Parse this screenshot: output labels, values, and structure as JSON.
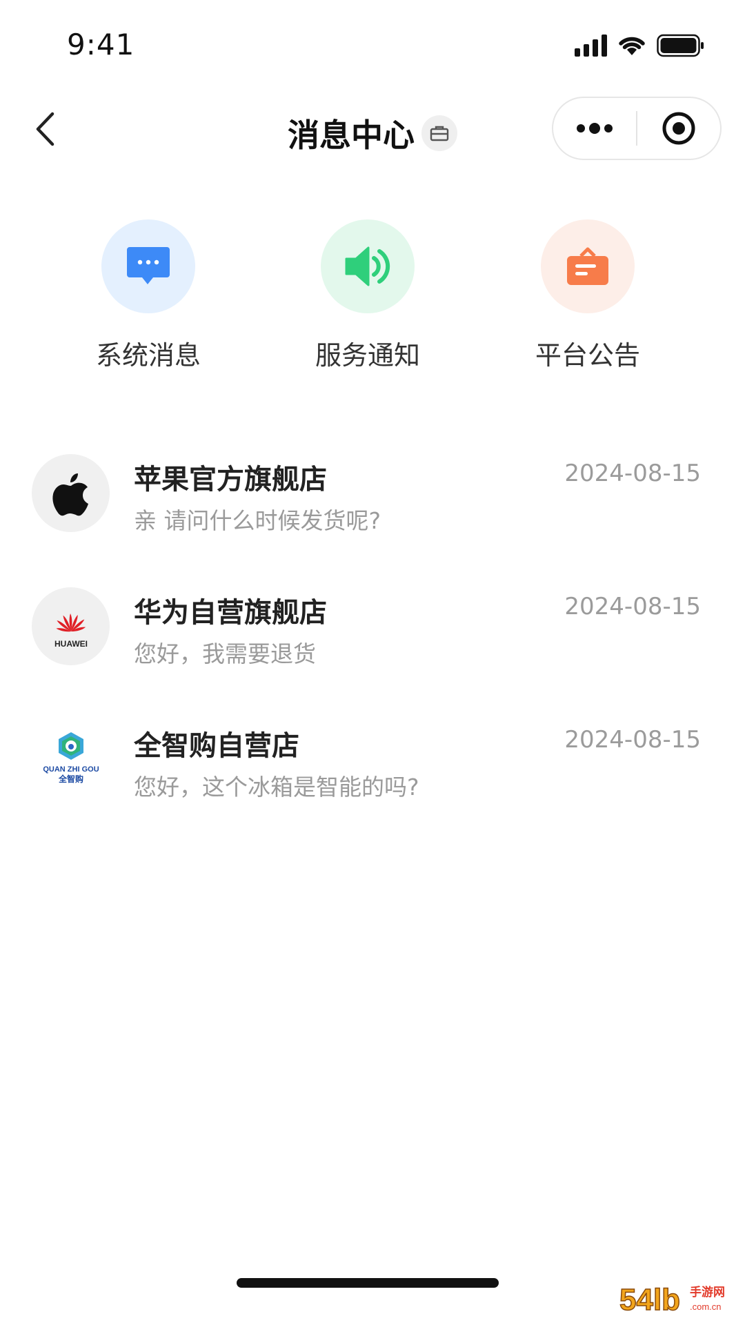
{
  "status_bar": {
    "time": "9:41",
    "icons": [
      "signal-icon",
      "wifi-icon",
      "battery-icon"
    ]
  },
  "nav": {
    "title": "消息中心",
    "back_icon": "chevron-left-icon",
    "title_badge_icon": "briefcase-icon",
    "more_icon": "more-dots-icon",
    "close_icon": "target-icon"
  },
  "categories": [
    {
      "label": "系统消息",
      "icon": "chat-bubble-icon",
      "color": "#3d8af7",
      "bg": "#e4f0fe"
    },
    {
      "label": "服务通知",
      "icon": "speaker-icon",
      "color": "#2fcf7b",
      "bg": "#e3f8ec"
    },
    {
      "label": "平台公告",
      "icon": "notice-board-icon",
      "color": "#f77c4a",
      "bg": "#fdeee8"
    }
  ],
  "conversations": [
    {
      "name": "苹果官方旗舰店",
      "message": "亲  请问什么时候发货呢?",
      "date": "2024-08-15",
      "avatar_icon": "apple-logo-icon"
    },
    {
      "name": "华为自营旗舰店",
      "message": "您好，我需要退货",
      "date": "2024-08-15",
      "avatar_icon": "huawei-logo-icon",
      "avatar_text": "HUAWEI"
    },
    {
      "name": "全智购自营店",
      "message": "您好，这个冰箱是智能的吗?",
      "date": "2024-08-15",
      "avatar_icon": "quanzhigou-logo-icon",
      "avatar_text_en": "QUAN ZHI GOU",
      "avatar_text_cn": "全智购"
    }
  ],
  "watermark": {
    "text": "54lb",
    "sub": "手游网",
    "domain": ".com.cn"
  },
  "colors": {
    "accent_blue": "#3d8af7",
    "accent_green": "#2fcf7b",
    "accent_orange": "#f77c4a",
    "huawei_red": "#e01f26"
  }
}
